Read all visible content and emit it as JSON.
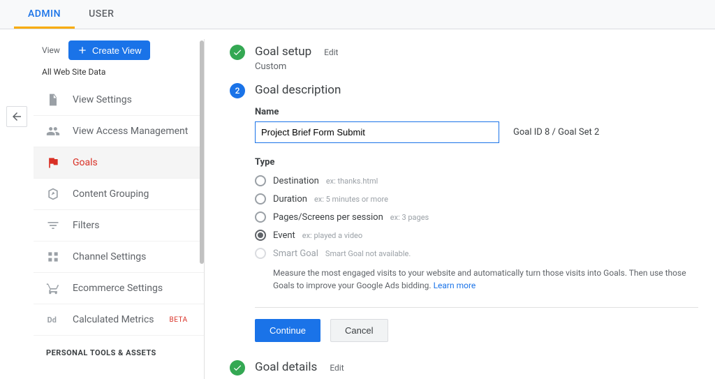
{
  "tabs": {
    "admin": "ADMIN",
    "user": "USER"
  },
  "sidebar": {
    "view_label": "View",
    "create_view": "Create View",
    "view_name": "All Web Site Data",
    "items": [
      {
        "label": "View Settings"
      },
      {
        "label": "View Access Management"
      },
      {
        "label": "Goals"
      },
      {
        "label": "Content Grouping"
      },
      {
        "label": "Filters"
      },
      {
        "label": "Channel Settings"
      },
      {
        "label": "Ecommerce Settings"
      },
      {
        "label": "Calculated Metrics",
        "beta": "BETA"
      }
    ],
    "section_header": "PERSONAL TOOLS & ASSETS"
  },
  "steps": {
    "setup": {
      "title": "Goal setup",
      "edit": "Edit",
      "subtitle": "Custom"
    },
    "desc": {
      "num": "2",
      "title": "Goal description",
      "name_label": "Name",
      "name_value": "Project Brief Form Submit",
      "goal_id": "Goal ID 8 / Goal Set 2",
      "type_label": "Type",
      "types": {
        "destination": {
          "label": "Destination",
          "ex": "ex: thanks.html"
        },
        "duration": {
          "label": "Duration",
          "ex": "ex: 5 minutes or more"
        },
        "pages": {
          "label": "Pages/Screens per session",
          "ex": "ex: 3 pages"
        },
        "event": {
          "label": "Event",
          "ex": "ex: played a video"
        },
        "smart": {
          "label": "Smart Goal",
          "ex": "Smart Goal not available."
        }
      },
      "smart_desc": "Measure the most engaged visits to your website and automatically turn those visits into Goals. Then use those Goals to improve your Google Ads bidding.",
      "learn_more": "Learn more",
      "continue": "Continue",
      "cancel": "Cancel"
    },
    "details": {
      "title": "Goal details",
      "edit": "Edit"
    }
  }
}
